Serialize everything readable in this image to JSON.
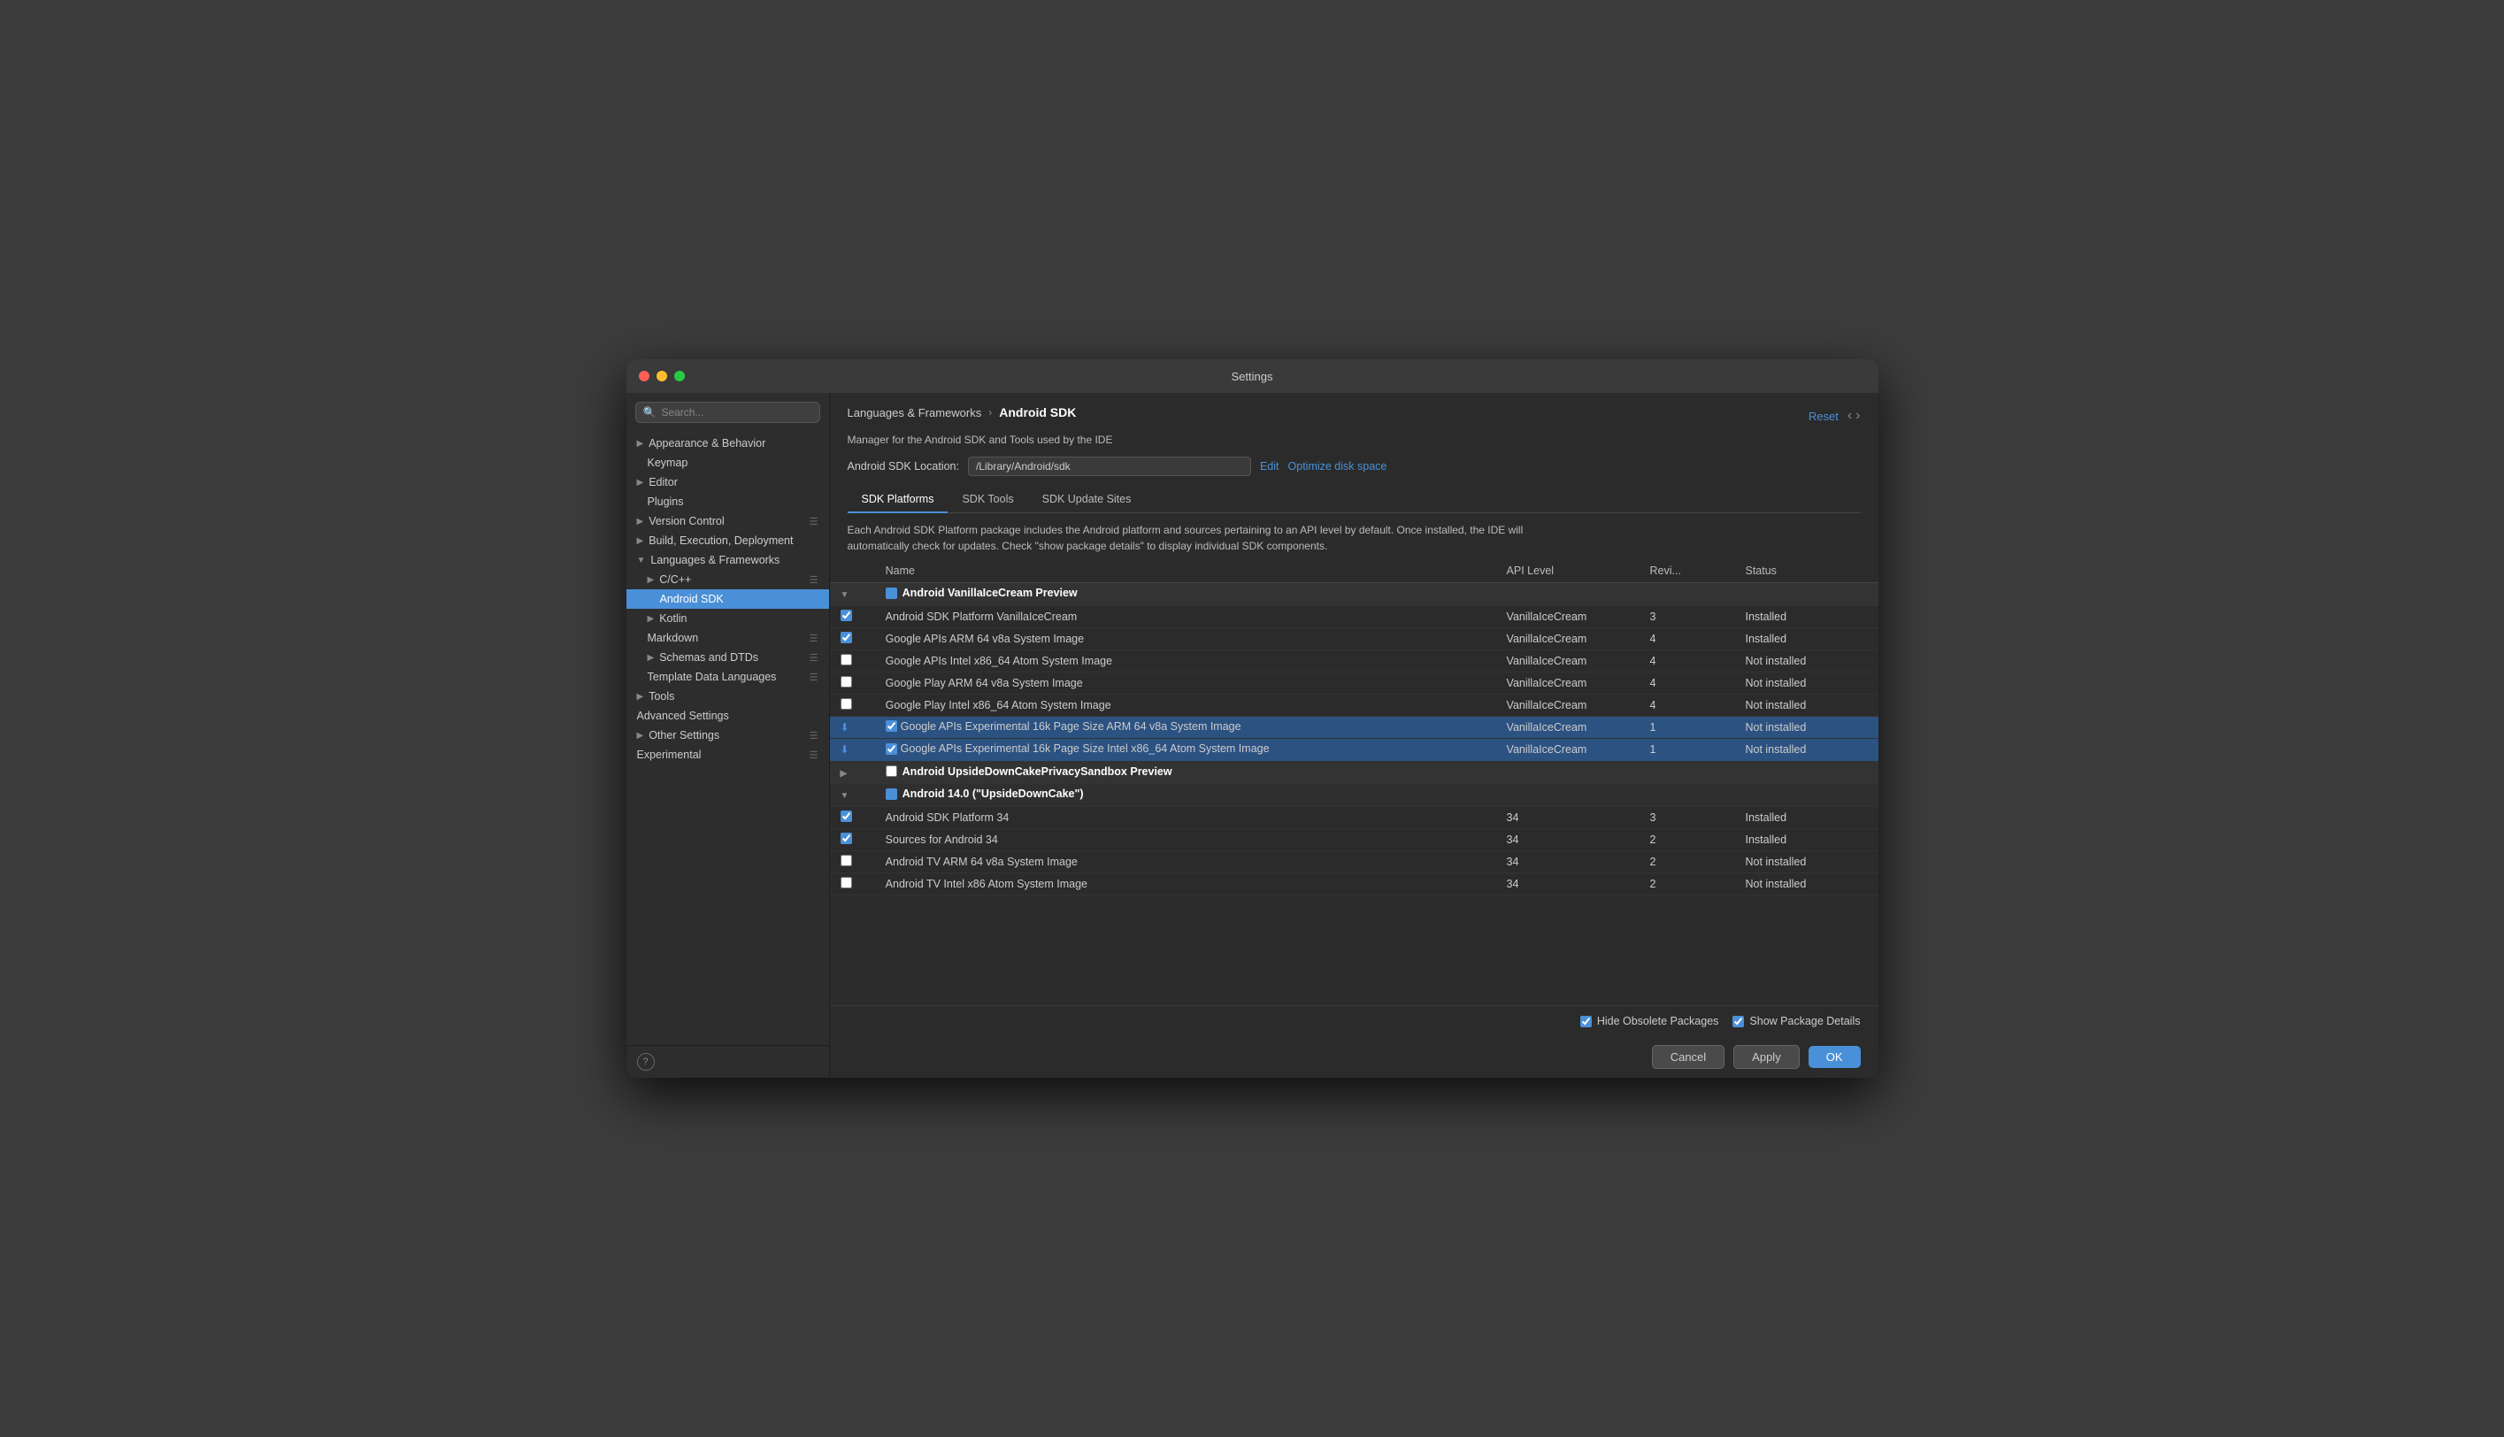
{
  "window": {
    "title": "Settings"
  },
  "sidebar": {
    "search_placeholder": "🔍",
    "items": [
      {
        "id": "appearance",
        "label": "Appearance & Behavior",
        "indent": 0,
        "expandable": true,
        "expanded": false
      },
      {
        "id": "keymap",
        "label": "Keymap",
        "indent": 0,
        "expandable": false
      },
      {
        "id": "editor",
        "label": "Editor",
        "indent": 0,
        "expandable": true,
        "expanded": false
      },
      {
        "id": "plugins",
        "label": "Plugins",
        "indent": 0,
        "expandable": false
      },
      {
        "id": "version-control",
        "label": "Version Control",
        "indent": 0,
        "expandable": true,
        "expanded": false,
        "has_icon": true
      },
      {
        "id": "build-exec",
        "label": "Build, Execution, Deployment",
        "indent": 0,
        "expandable": true,
        "expanded": false
      },
      {
        "id": "languages",
        "label": "Languages & Frameworks",
        "indent": 0,
        "expandable": true,
        "expanded": true
      },
      {
        "id": "cpp",
        "label": "C/C++",
        "indent": 1,
        "expandable": true,
        "expanded": false,
        "has_icon": true
      },
      {
        "id": "android-sdk",
        "label": "Android SDK",
        "indent": 2,
        "expandable": false,
        "selected": true
      },
      {
        "id": "kotlin",
        "label": "Kotlin",
        "indent": 1,
        "expandable": true,
        "expanded": false
      },
      {
        "id": "markdown",
        "label": "Markdown",
        "indent": 1,
        "expandable": false,
        "has_icon": true
      },
      {
        "id": "schemas",
        "label": "Schemas and DTDs",
        "indent": 1,
        "expandable": true,
        "expanded": false,
        "has_icon": true
      },
      {
        "id": "template",
        "label": "Template Data Languages",
        "indent": 1,
        "expandable": false,
        "has_icon": true
      },
      {
        "id": "tools",
        "label": "Tools",
        "indent": 0,
        "expandable": true,
        "expanded": false
      },
      {
        "id": "advanced",
        "label": "Advanced Settings",
        "indent": 0,
        "expandable": false
      },
      {
        "id": "other",
        "label": "Other Settings",
        "indent": 0,
        "expandable": true,
        "expanded": false,
        "has_icon": true
      },
      {
        "id": "experimental",
        "label": "Experimental",
        "indent": 0,
        "expandable": false,
        "has_icon": true
      }
    ],
    "help_label": "?"
  },
  "main": {
    "breadcrumb": {
      "parent": "Languages & Frameworks",
      "arrow": "›",
      "current": "Android SDK"
    },
    "description": "Manager for the Android SDK and Tools used by the IDE",
    "sdk_location_label": "Android SDK Location:",
    "sdk_location_value": "/Library/Android/sdk",
    "edit_label": "Edit",
    "optimize_label": "Optimize disk space",
    "reset_label": "Reset",
    "tabs": [
      {
        "id": "platforms",
        "label": "SDK Platforms",
        "active": true
      },
      {
        "id": "tools",
        "label": "SDK Tools"
      },
      {
        "id": "update-sites",
        "label": "SDK Update Sites"
      }
    ],
    "table_description": "Each Android SDK Platform package includes the Android platform and sources pertaining to an API level by default. Once installed, the IDE will automatically check for updates. Check \"show package details\" to display individual SDK components.",
    "columns": [
      {
        "id": "name",
        "label": "Name"
      },
      {
        "id": "api",
        "label": "API Level"
      },
      {
        "id": "rev",
        "label": "Revi..."
      },
      {
        "id": "status",
        "label": "Status"
      }
    ],
    "rows": [
      {
        "type": "group",
        "indent": 0,
        "expand_state": "expanded",
        "checkbox": "mixed",
        "name": "Android VanillaIceCream Preview",
        "api": "",
        "rev": "",
        "status": ""
      },
      {
        "type": "item",
        "indent": 1,
        "checkbox": "checked",
        "name": "Android SDK Platform VanillaIceCream",
        "api": "VanillaIceCream",
        "rev": "3",
        "status": "Installed"
      },
      {
        "type": "item",
        "indent": 1,
        "checkbox": "checked",
        "name": "Google APIs ARM 64 v8a System Image",
        "api": "VanillaIceCream",
        "rev": "4",
        "status": "Installed"
      },
      {
        "type": "item",
        "indent": 1,
        "checkbox": "unchecked",
        "name": "Google APIs Intel x86_64 Atom System Image",
        "api": "VanillaIceCream",
        "rev": "4",
        "status": "Not installed"
      },
      {
        "type": "item",
        "indent": 1,
        "checkbox": "unchecked",
        "name": "Google Play ARM 64 v8a System Image",
        "api": "VanillaIceCream",
        "rev": "4",
        "status": "Not installed"
      },
      {
        "type": "item",
        "indent": 1,
        "checkbox": "unchecked",
        "name": "Google Play Intel x86_64 Atom System Image",
        "api": "VanillaIceCream",
        "rev": "4",
        "status": "Not installed"
      },
      {
        "type": "item",
        "indent": 1,
        "checkbox": "checked",
        "download": true,
        "selected": true,
        "name": "Google APIs Experimental 16k Page Size ARM 64 v8a System Image",
        "api": "VanillaIceCream",
        "rev": "1",
        "status": "Not installed"
      },
      {
        "type": "item",
        "indent": 1,
        "checkbox": "checked",
        "download": true,
        "selected": true,
        "name": "Google APIs Experimental 16k Page Size Intel x86_64 Atom System Image",
        "api": "VanillaIceCream",
        "rev": "1",
        "status": "Not installed"
      },
      {
        "type": "group",
        "indent": 0,
        "expand_state": "collapsed",
        "checkbox": "unchecked",
        "name": "Android UpsideDownCakePrivacySandbox Preview",
        "api": "",
        "rev": "",
        "status": ""
      },
      {
        "type": "group",
        "indent": 0,
        "expand_state": "expanded",
        "checkbox": "mixed",
        "name": "Android 14.0 (\"UpsideDownCake\")",
        "api": "",
        "rev": "",
        "status": ""
      },
      {
        "type": "item",
        "indent": 1,
        "checkbox": "checked",
        "name": "Android SDK Platform 34",
        "api": "34",
        "rev": "3",
        "status": "Installed"
      },
      {
        "type": "item",
        "indent": 1,
        "checkbox": "checked",
        "name": "Sources for Android 34",
        "api": "34",
        "rev": "2",
        "status": "Installed"
      },
      {
        "type": "item",
        "indent": 1,
        "checkbox": "unchecked",
        "name": "Android TV ARM 64 v8a System Image",
        "api": "34",
        "rev": "2",
        "status": "Not installed"
      },
      {
        "type": "item",
        "indent": 1,
        "checkbox": "unchecked",
        "name": "Android TV Intel x86 Atom System Image",
        "api": "34",
        "rev": "2",
        "status": "Not installed"
      }
    ],
    "footer": {
      "hide_obsolete": true,
      "hide_obsolete_label": "Hide Obsolete Packages",
      "show_details": true,
      "show_details_label": "Show Package Details"
    },
    "buttons": {
      "cancel": "Cancel",
      "apply": "Apply",
      "ok": "OK"
    }
  }
}
